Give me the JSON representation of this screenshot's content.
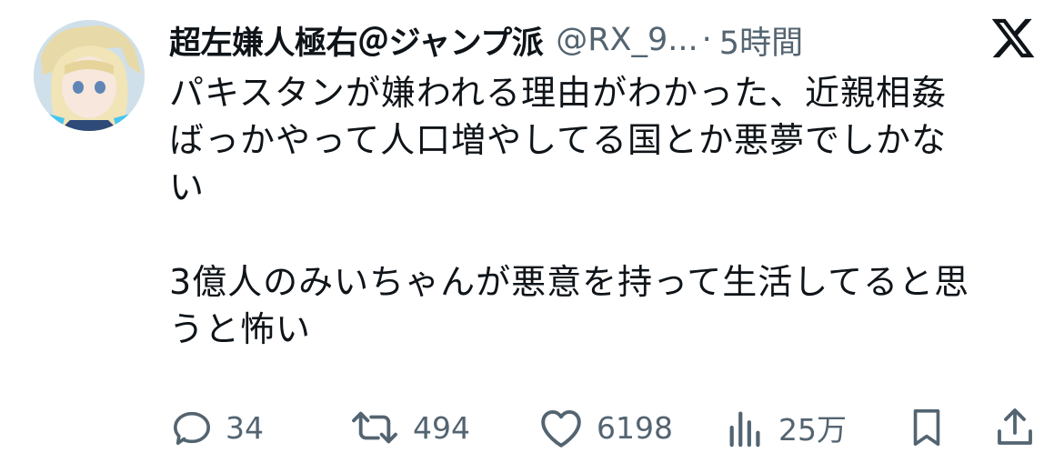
{
  "post": {
    "display_name": "超左嫌人極右＠ジャンプ派",
    "handle": "@RX_9...",
    "separator": "·",
    "time": "5時間",
    "text": "パキスタンが嫌われる理由がわかった、近親相姦\nばっかやって人口増やしてる国とか悪夢でしかな\nい\n\n3億人のみいちゃんが悪意を持って生活してると思\nうと怖い"
  },
  "actions": {
    "replies": "34",
    "reposts": "494",
    "likes": "6198",
    "views": "25万"
  },
  "icons": {
    "platform": "x-logo-icon",
    "reply": "reply-icon",
    "repost": "repost-icon",
    "like": "heart-icon",
    "views": "views-icon",
    "bookmark": "bookmark-icon",
    "share": "share-icon"
  },
  "colors": {
    "text_primary": "#0f1419",
    "text_secondary": "#536471",
    "background": "#ffffff"
  }
}
